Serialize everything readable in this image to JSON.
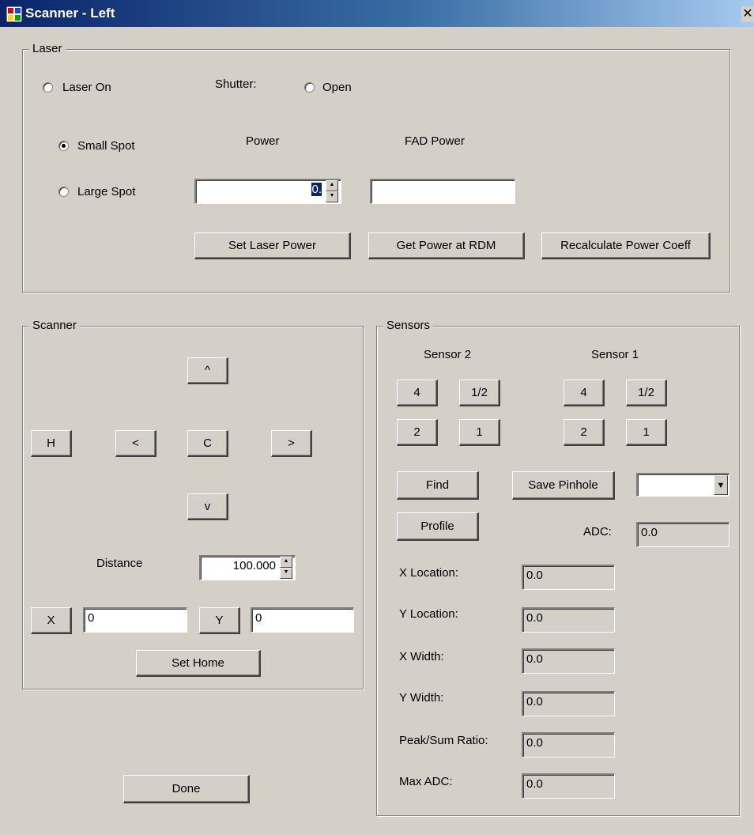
{
  "window": {
    "title": "Scanner - Left",
    "close_glyph": "✕"
  },
  "laser": {
    "group_label": "Laser",
    "laser_on_label": "Laser On",
    "shutter_label": "Shutter:",
    "open_label": "Open",
    "small_spot_label": "Small Spot",
    "large_spot_label": "Large Spot",
    "spot_selected": "small",
    "power_label": "Power",
    "fad_power_label": "FAD Power",
    "power_value": "0.",
    "fad_power_value": "",
    "set_laser_power": "Set Laser Power",
    "get_power_rdm": "Get Power at RDM",
    "recalc_power": "Recalculate Power Coeff"
  },
  "scanner": {
    "group_label": "Scanner",
    "up": "^",
    "down": "v",
    "left": "<",
    "right": ">",
    "center": "C",
    "home": "H",
    "distance_label": "Distance",
    "distance_value": "100.000",
    "x_button": "X",
    "x_value": "0",
    "y_button": "Y",
    "y_value": "0",
    "set_home": "Set Home"
  },
  "sensors": {
    "group_label": "Sensors",
    "sensor2_label": "Sensor 2",
    "sensor1_label": "Sensor 1",
    "btn_4": "4",
    "btn_half": "1/2",
    "btn_2": "2",
    "btn_1": "1",
    "find": "Find",
    "profile": "Profile",
    "save_pinhole": "Save Pinhole",
    "dropdown_value": "",
    "adc_label": "ADC:",
    "adc_value": "0.0",
    "x_location_label": "X Location:",
    "x_location_value": "0.0",
    "y_location_label": "Y Location:",
    "y_location_value": "0.0",
    "x_width_label": "X Width:",
    "x_width_value": "0.0",
    "y_width_label": "Y Width:",
    "y_width_value": "0.0",
    "peak_sum_label": "Peak/Sum Ratio:",
    "peak_sum_value": "0.0",
    "max_adc_label": "Max ADC:",
    "max_adc_value": "0.0"
  },
  "done": "Done"
}
